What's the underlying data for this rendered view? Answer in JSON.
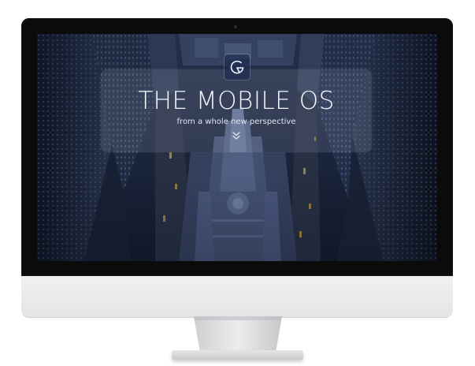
{
  "hero": {
    "title": "THE MOBILE OS",
    "subtitle": "from a whole new perspective",
    "logo_icon": "g-logo-icon",
    "scroll_icon": "double-chevron-down-icon"
  },
  "colors": {
    "bezel": "#0b0b0c",
    "chin": "#e8e8ea",
    "title_text": "#f4f6fb",
    "accent_city": "#d8b04a"
  }
}
